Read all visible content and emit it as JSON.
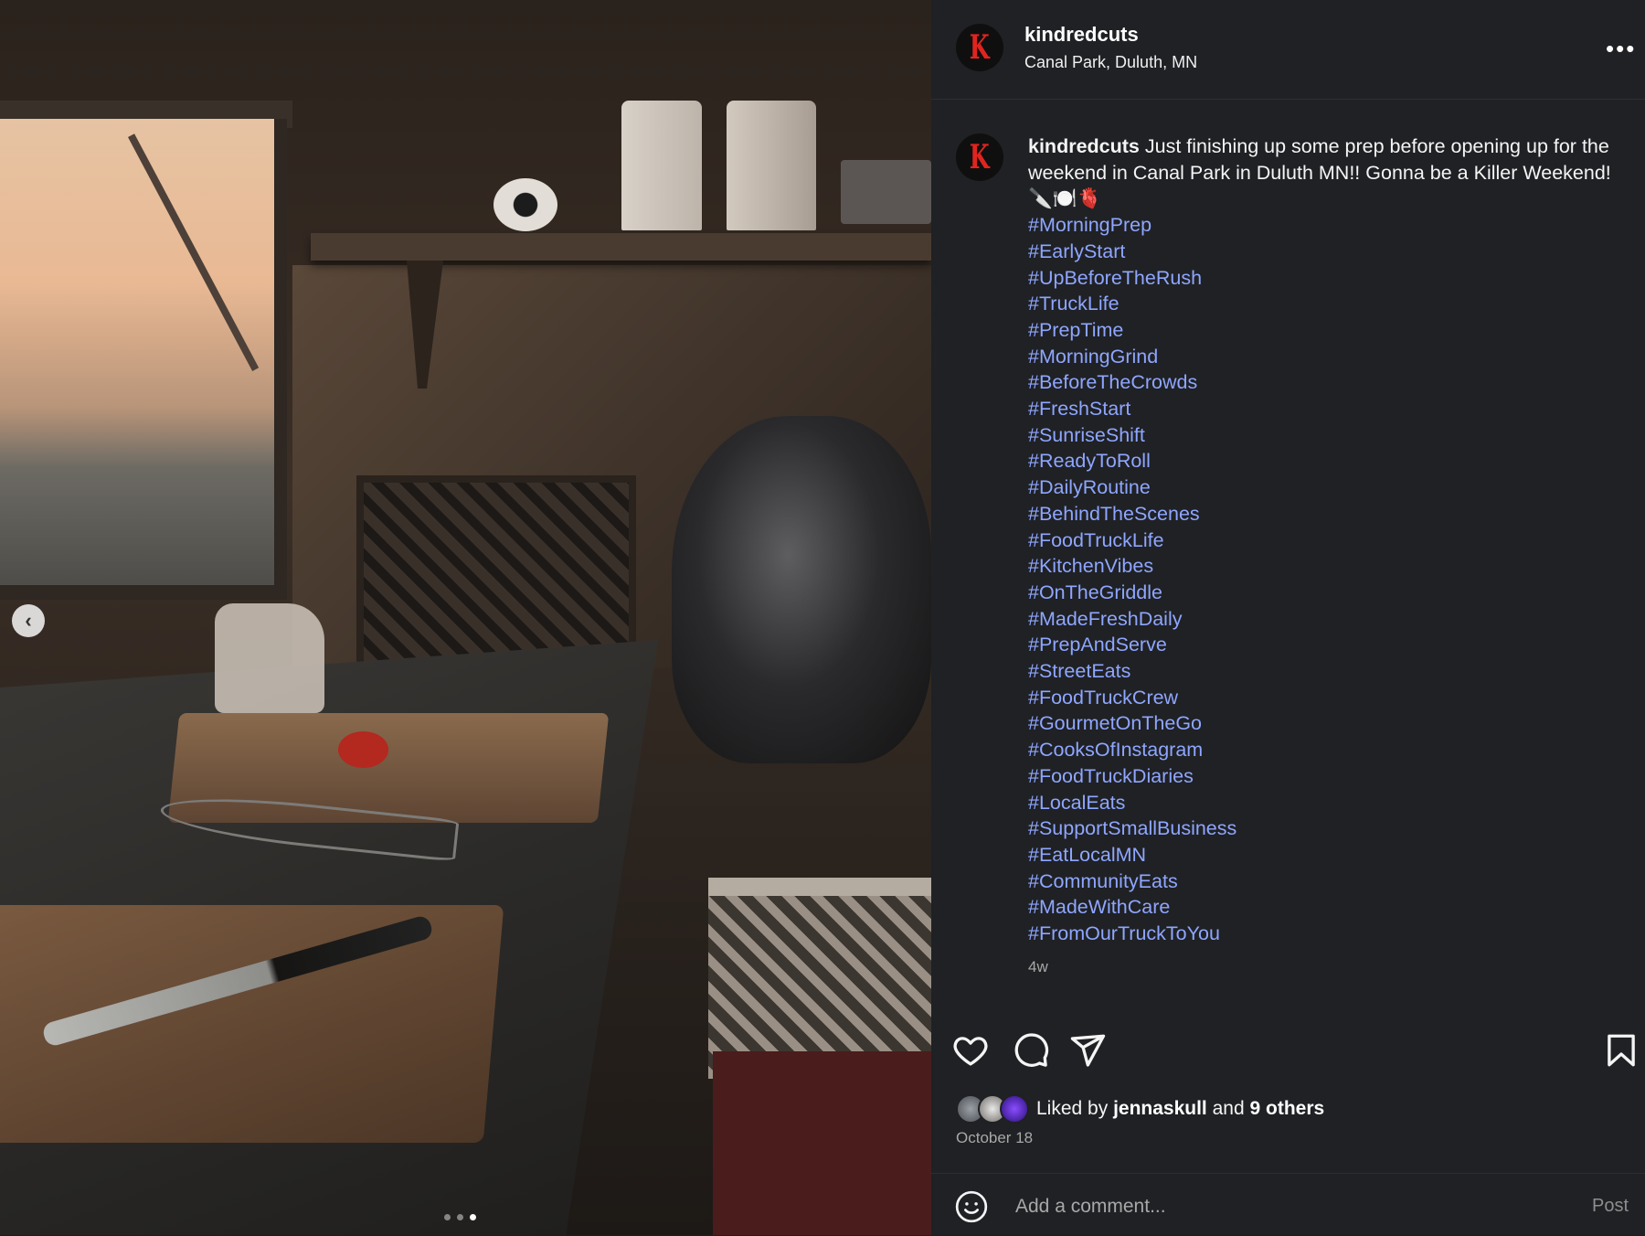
{
  "post": {
    "username": "kindredcuts",
    "location": "Canal Park, Duluth, MN",
    "avatar_letter": "K",
    "more_glyph": "•••"
  },
  "caption": {
    "username": "kindredcuts",
    "text": "Just finishing up some prep before opening up for the weekend in Canal Park in Duluth MN!! Gonna be a Killer Weekend! 🔪🍽️🫀",
    "hashtags": [
      "#MorningPrep",
      "#EarlyStart",
      "#UpBeforeTheRush",
      "#TruckLife",
      "#PrepTime",
      "#MorningGrind",
      "#BeforeTheCrowds",
      "#FreshStart",
      "#SunriseShift",
      "#ReadyToRoll",
      "#DailyRoutine",
      "#BehindTheScenes",
      "#FoodTruckLife",
      "#KitchenVibes",
      "#OnTheGriddle",
      "#MadeFreshDaily",
      "#PrepAndServe",
      "#StreetEats",
      "#FoodTruckCrew",
      "#GourmetOnTheGo",
      "#CooksOfInstagram",
      "#FoodTruckDiaries",
      "#LocalEats",
      "#SupportSmallBusiness",
      "#EatLocalMN",
      "#CommunityEats",
      "#MadeWithCare",
      "#FromOurTruckToYou"
    ],
    "age": "4w"
  },
  "carousel": {
    "prev_glyph": "‹",
    "slide_count": 3,
    "active_index": 2
  },
  "actions": {
    "icons": [
      "heart-icon",
      "comment-icon",
      "share-icon",
      "bookmark-icon"
    ]
  },
  "likes": {
    "prefix": "Liked by",
    "user": "jennaskull",
    "joiner": "and",
    "others": "9 others",
    "date": "October 18"
  },
  "comment": {
    "placeholder": "Add a comment...",
    "post_label": "Post"
  },
  "colors": {
    "panel_bg": "#1f2124",
    "hashtag": "#8fa6ff",
    "brand_red": "#e0241f"
  }
}
